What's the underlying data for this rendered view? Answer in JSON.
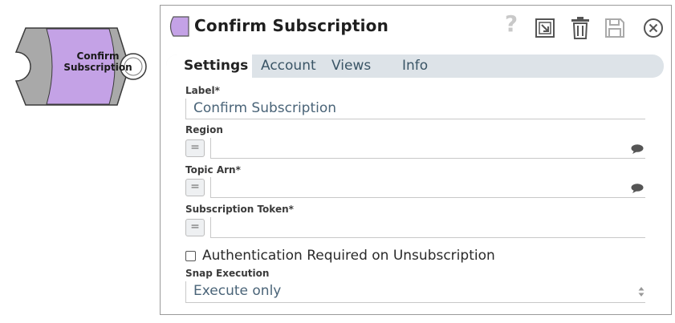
{
  "node": {
    "label_line1": "Confirm",
    "label_line2": "Subscription",
    "accent_color": "#c4a2e6"
  },
  "dialog": {
    "title": "Confirm Subscription",
    "toolbar": {
      "help_icon": "question-icon",
      "expand_icon": "expand-icon",
      "delete_icon": "trash-icon",
      "save_icon": "save-icon",
      "close_icon": "close-circle-icon",
      "help_glyph": "?"
    },
    "tabs": [
      {
        "label": "Settings",
        "active": true
      },
      {
        "label": "Account"
      },
      {
        "label": "Views"
      },
      {
        "label": "Info"
      }
    ]
  },
  "form": {
    "label": {
      "title": "Label*",
      "value": "Confirm Subscription"
    },
    "region": {
      "title": "Region",
      "value": "",
      "expr_glyph": "="
    },
    "topic_arn": {
      "title": "Topic Arn*",
      "value": "",
      "expr_glyph": "="
    },
    "subscription_token": {
      "title": "Subscription Token*",
      "value": "",
      "expr_glyph": "="
    },
    "auth_required": {
      "label": "Authentication Required on Unsubscription",
      "checked": false
    },
    "snap_execution": {
      "title": "Snap Execution",
      "value": "Execute only"
    }
  }
}
